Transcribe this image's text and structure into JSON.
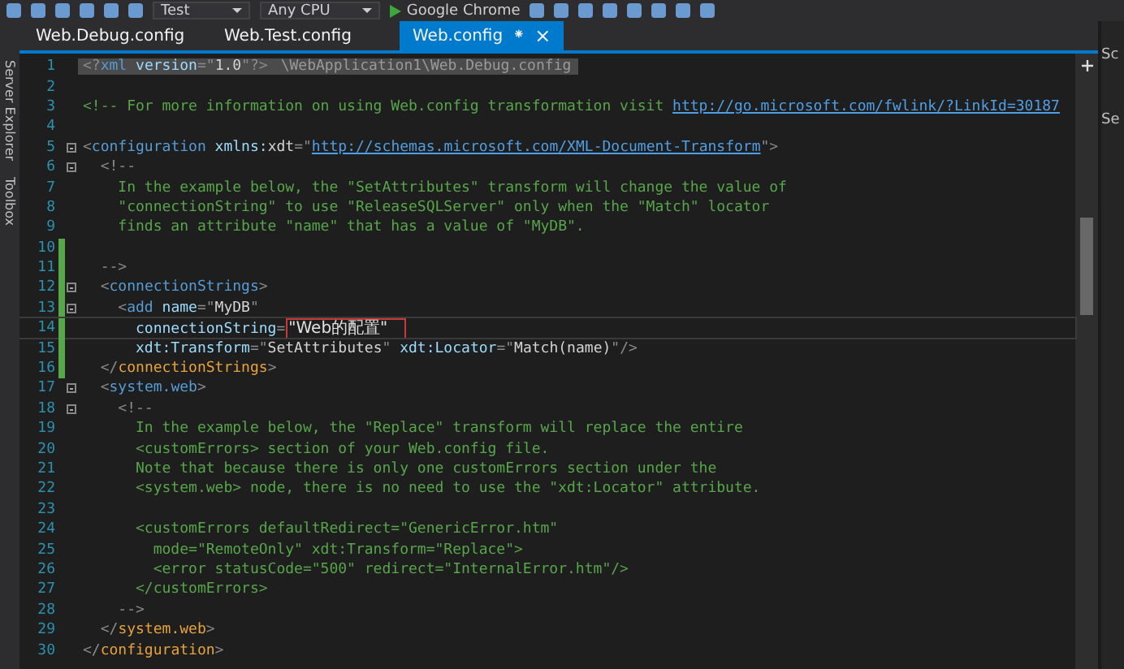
{
  "toolbar": {
    "items": [
      {
        "kind": "combo",
        "label": "Test"
      },
      {
        "kind": "combo",
        "label": "Any CPU"
      },
      {
        "kind": "run",
        "label": "Google Chrome"
      }
    ]
  },
  "side_panel": {
    "labels": [
      "Server Explorer",
      "Toolbox"
    ]
  },
  "tabs": [
    {
      "label": "Web.Debug.config",
      "selected": false
    },
    {
      "label": "Web.Test.config",
      "selected": false
    },
    {
      "label": "Web.config",
      "selected": true,
      "pin": "⁕",
      "close": "×"
    }
  ],
  "tooltip": {
    "text": "\\WebApplication1\\Web.Debug.config"
  },
  "right_panel": {
    "labels": [
      "Sc",
      "Se"
    ]
  },
  "editor": {
    "lines": [
      {
        "n": "1",
        "fold": false,
        "changed": false,
        "current": false,
        "segs": [
          {
            "kind": "punct",
            "text": "<?"
          },
          {
            "kind": "tag",
            "text": "xml"
          },
          {
            "kind": "attr",
            "text": " version"
          },
          {
            "kind": "punct",
            "text": "=\""
          },
          {
            "kind": "value",
            "text": "1.0"
          },
          {
            "kind": "punct",
            "text": "\"?>"
          }
        ]
      },
      {
        "n": "2",
        "fold": false,
        "changed": false,
        "current": false
      },
      {
        "n": "3",
        "fold": false,
        "changed": false,
        "current": false,
        "segs": [
          {
            "kind": "comment",
            "text": "<!-- For more information on using Web.config transformation visit "
          },
          {
            "kind": "link",
            "text": "http://go.microsoft.com/fwlink/?LinkId=30187"
          }
        ]
      },
      {
        "n": "4",
        "fold": false,
        "changed": false,
        "current": false
      },
      {
        "n": "5",
        "fold": true,
        "changed": false,
        "current": false,
        "segs": [
          {
            "kind": "punct",
            "text": "<"
          },
          {
            "kind": "tag",
            "text": "configuration"
          },
          {
            "kind": "attr",
            "text": " xmlns:"
          },
          {
            "kind": "value",
            "text": "xdt"
          },
          {
            "kind": "punct",
            "text": "=\""
          },
          {
            "kind": "link",
            "text": "http://schemas.microsoft.com/XML-Document-Transform"
          },
          {
            "kind": "punct",
            "text": "\">"
          }
        ]
      },
      {
        "n": "6",
        "fold": true,
        "changed": false,
        "current": false,
        "segs": [
          {
            "kind": "punct",
            "text": "  <!--"
          }
        ]
      },
      {
        "n": "7",
        "fold": false,
        "changed": false,
        "current": false,
        "segs": [
          {
            "kind": "comment",
            "text": "    In the example below, the \"SetAttributes\" transform will change the value of"
          }
        ]
      },
      {
        "n": "8",
        "fold": false,
        "changed": false,
        "current": false,
        "segs": [
          {
            "kind": "comment",
            "text": "    \"connectionString\" to use \"ReleaseSQLServer\" only when the \"Match\" locator"
          }
        ]
      },
      {
        "n": "9",
        "fold": false,
        "changed": false,
        "current": false,
        "segs": [
          {
            "kind": "comment",
            "text": "    finds an attribute \"name\" that has a value of \"MyDB\"."
          }
        ]
      },
      {
        "n": "10",
        "fold": false,
        "changed": true,
        "current": false
      },
      {
        "n": "11",
        "fold": false,
        "changed": true,
        "current": false,
        "segs": [
          {
            "kind": "punct",
            "text": "  -->"
          }
        ]
      },
      {
        "n": "12",
        "fold": true,
        "changed": true,
        "current": false,
        "segs": [
          {
            "kind": "punct",
            "text": "  <"
          },
          {
            "kind": "tag",
            "text": "connectionStrings"
          },
          {
            "kind": "punct",
            "text": ">"
          }
        ]
      },
      {
        "n": "13",
        "fold": true,
        "changed": true,
        "current": false,
        "segs": [
          {
            "kind": "punct",
            "text": "    <"
          },
          {
            "kind": "tag",
            "text": "add"
          },
          {
            "kind": "attr",
            "text": " name"
          },
          {
            "kind": "punct",
            "text": "=\""
          },
          {
            "kind": "value",
            "text": "MyDB"
          },
          {
            "kind": "punct",
            "text": "\""
          }
        ]
      },
      {
        "n": "14",
        "fold": false,
        "changed": true,
        "current": true,
        "segs": [
          {
            "kind": "attr",
            "text": "      connectionString"
          },
          {
            "kind": "punct",
            "text": "="
          },
          {
            "kind": "boxed",
            "text": "\"Web的配置\""
          }
        ]
      },
      {
        "n": "15",
        "fold": false,
        "changed": true,
        "current": false,
        "segs": [
          {
            "kind": "attr",
            "text": "      xdt:Transform"
          },
          {
            "kind": "punct",
            "text": "=\""
          },
          {
            "kind": "value",
            "text": "SetAttributes"
          },
          {
            "kind": "punct",
            "text": "\""
          },
          {
            "kind": "attr",
            "text": " xdt:Locator"
          },
          {
            "kind": "punct",
            "text": "=\""
          },
          {
            "kind": "value",
            "text": "Match(name)"
          },
          {
            "kind": "punct",
            "text": "\"/>"
          }
        ]
      },
      {
        "n": "16",
        "fold": false,
        "changed": true,
        "current": false,
        "segs": [
          {
            "kind": "punct",
            "text": "  </"
          },
          {
            "kind": "match",
            "text": "connectionStrings"
          },
          {
            "kind": "punct",
            "text": ">"
          }
        ]
      },
      {
        "n": "17",
        "fold": true,
        "changed": false,
        "current": false,
        "segs": [
          {
            "kind": "punct",
            "text": "  <"
          },
          {
            "kind": "tag",
            "text": "system.web"
          },
          {
            "kind": "punct",
            "text": ">"
          }
        ]
      },
      {
        "n": "18",
        "fold": true,
        "changed": false,
        "current": false,
        "segs": [
          {
            "kind": "punct",
            "text": "    <!--"
          }
        ]
      },
      {
        "n": "19",
        "fold": false,
        "changed": false,
        "current": false,
        "segs": [
          {
            "kind": "comment",
            "text": "      In the example below, the \"Replace\" transform will replace the entire"
          }
        ]
      },
      {
        "n": "20",
        "fold": false,
        "changed": false,
        "current": false,
        "segs": [
          {
            "kind": "comment",
            "text": "      <customErrors> section of your Web.config file."
          }
        ]
      },
      {
        "n": "21",
        "fold": false,
        "changed": false,
        "current": false,
        "segs": [
          {
            "kind": "comment",
            "text": "      Note that because there is only one customErrors section under the"
          }
        ]
      },
      {
        "n": "22",
        "fold": false,
        "changed": false,
        "current": false,
        "segs": [
          {
            "kind": "comment",
            "text": "      <system.web> node, there is no need to use the \"xdt:Locator\" attribute."
          }
        ]
      },
      {
        "n": "23",
        "fold": false,
        "changed": false,
        "current": false
      },
      {
        "n": "24",
        "fold": false,
        "changed": false,
        "current": false,
        "segs": [
          {
            "kind": "comment",
            "text": "      <customErrors defaultRedirect=\"GenericError.htm\""
          }
        ]
      },
      {
        "n": "25",
        "fold": false,
        "changed": false,
        "current": false,
        "segs": [
          {
            "kind": "comment",
            "text": "        mode=\"RemoteOnly\" xdt:Transform=\"Replace\">"
          }
        ]
      },
      {
        "n": "26",
        "fold": false,
        "changed": false,
        "current": false,
        "segs": [
          {
            "kind": "comment",
            "text": "        <error statusCode=\"500\" redirect=\"InternalError.htm\"/>"
          }
        ]
      },
      {
        "n": "27",
        "fold": false,
        "changed": false,
        "current": false,
        "segs": [
          {
            "kind": "comment",
            "text": "      </customErrors>"
          }
        ]
      },
      {
        "n": "28",
        "fold": false,
        "changed": false,
        "current": false,
        "segs": [
          {
            "kind": "punct",
            "text": "    -->"
          }
        ]
      },
      {
        "n": "29",
        "fold": false,
        "changed": false,
        "current": false,
        "segs": [
          {
            "kind": "punct",
            "text": "  </"
          },
          {
            "kind": "match",
            "text": "system.web"
          },
          {
            "kind": "punct",
            "text": ">"
          }
        ]
      },
      {
        "n": "30",
        "fold": false,
        "changed": false,
        "current": false,
        "segs": [
          {
            "kind": "punct",
            "text": "</"
          },
          {
            "kind": "match",
            "text": "configuration"
          },
          {
            "kind": "punct",
            "text": ">"
          }
        ]
      }
    ]
  }
}
